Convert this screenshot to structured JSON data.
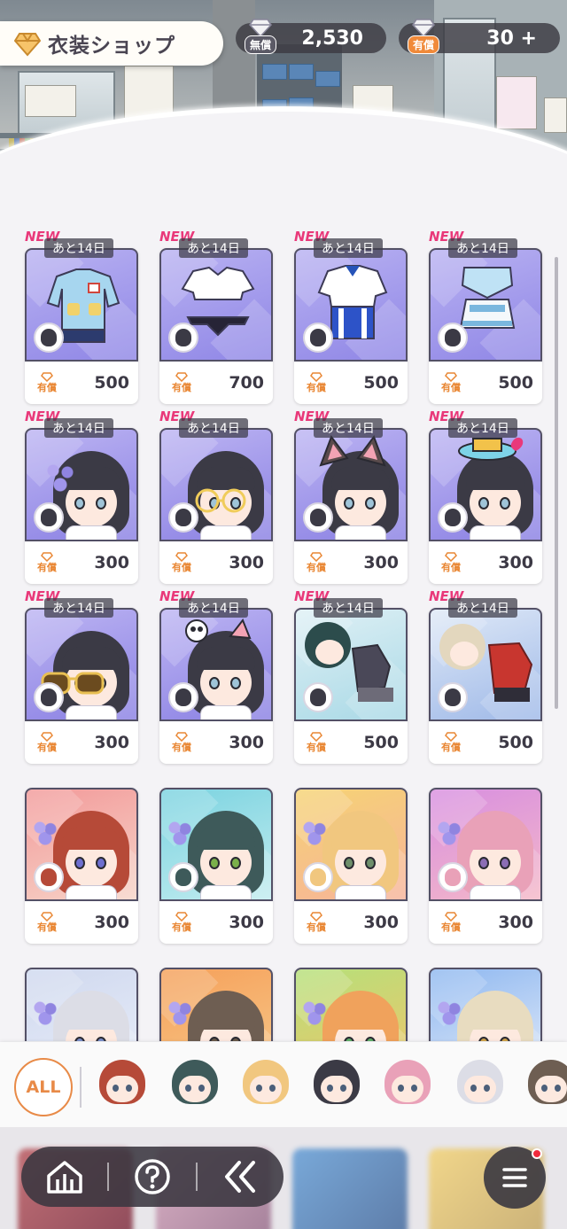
{
  "header": {
    "title": "衣装ショップ",
    "free_currency": {
      "tag": "無償",
      "value": "2,530"
    },
    "paid_currency": {
      "tag": "有償",
      "value": "30 +"
    }
  },
  "colors": {
    "accent": "#e88a47",
    "new": "#e9397a",
    "dark": "#3c3945"
  },
  "items": [
    {
      "new": "NEW",
      "days": "あと14日",
      "tag": "有償",
      "price": "500",
      "kind": "outfit",
      "icon": "kindergarten-uniform"
    },
    {
      "new": "NEW",
      "days": "あと14日",
      "tag": "有償",
      "price": "700",
      "kind": "outfit",
      "icon": "crop-top-outfit"
    },
    {
      "new": "NEW",
      "days": "あと14日",
      "tag": "有償",
      "price": "500",
      "kind": "outfit",
      "icon": "gym-uniform"
    },
    {
      "new": "NEW",
      "days": "あと14日",
      "tag": "有償",
      "price": "500",
      "kind": "outfit",
      "icon": "sailor-uniform"
    },
    {
      "new": "NEW",
      "days": "あと14日",
      "tag": "有償",
      "price": "300",
      "kind": "accessory",
      "icon": "flower-accessory"
    },
    {
      "new": "NEW",
      "days": "あと14日",
      "tag": "有償",
      "price": "300",
      "kind": "accessory",
      "icon": "glasses-accessory"
    },
    {
      "new": "NEW",
      "days": "あと14日",
      "tag": "有償",
      "price": "300",
      "kind": "accessory",
      "icon": "cat-ears-accessory"
    },
    {
      "new": "NEW",
      "days": "あと14日",
      "tag": "有償",
      "price": "300",
      "kind": "accessory",
      "icon": "hat-accessory"
    },
    {
      "new": "NEW",
      "days": "あと14日",
      "tag": "有償",
      "price": "300",
      "kind": "accessory",
      "icon": "sunglasses-accessory"
    },
    {
      "new": "NEW",
      "days": "あと14日",
      "tag": "有償",
      "price": "300",
      "kind": "accessory",
      "icon": "skull-clip-accessory"
    },
    {
      "new": "NEW",
      "days": "あと14日",
      "tag": "有償",
      "price": "500",
      "kind": "outfit-set",
      "icon": "dark-outfit-set"
    },
    {
      "new": "NEW",
      "days": "あと14日",
      "tag": "有償",
      "price": "500",
      "kind": "outfit-set",
      "icon": "red-outfit-set"
    },
    {
      "new": "",
      "days": "",
      "tag": "有償",
      "price": "300",
      "kind": "character",
      "icon": "flower-hair-red"
    },
    {
      "new": "",
      "days": "",
      "tag": "有償",
      "price": "300",
      "kind": "character",
      "icon": "flower-hair-teal"
    },
    {
      "new": "",
      "days": "",
      "tag": "有償",
      "price": "300",
      "kind": "character",
      "icon": "flower-hair-blonde"
    },
    {
      "new": "",
      "days": "",
      "tag": "有償",
      "price": "300",
      "kind": "character",
      "icon": "flower-hair-pink"
    },
    {
      "new": "",
      "days": "",
      "tag": "",
      "price": "",
      "kind": "character",
      "icon": "flower-hair-silver"
    },
    {
      "new": "",
      "days": "",
      "tag": "",
      "price": "",
      "kind": "character",
      "icon": "flower-hair-brown"
    },
    {
      "new": "",
      "days": "",
      "tag": "",
      "price": "",
      "kind": "character",
      "icon": "flower-hair-orange"
    },
    {
      "new": "",
      "days": "",
      "tag": "",
      "price": "",
      "kind": "character",
      "icon": "flower-hair-cream"
    }
  ],
  "character_filter": {
    "all_label": "ALL",
    "characters": [
      {
        "icon": "red-hair-character-icon"
      },
      {
        "icon": "teal-hair-character-icon"
      },
      {
        "icon": "blonde-hair-character-icon"
      },
      {
        "icon": "black-hair-character-icon"
      },
      {
        "icon": "pink-hair-character-icon"
      },
      {
        "icon": "silver-hair-character-icon"
      },
      {
        "icon": "brown-hair-character-icon"
      }
    ]
  },
  "nav": {
    "buttons": [
      {
        "icon": "home-icon"
      },
      {
        "icon": "help-icon"
      },
      {
        "icon": "back-icon"
      }
    ],
    "menu_icon": "menu-icon"
  }
}
